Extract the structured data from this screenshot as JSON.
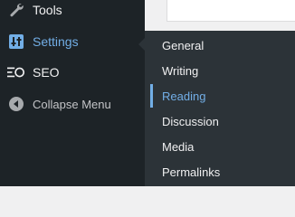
{
  "menu": {
    "tools": {
      "label": "Tools",
      "icon": "wrench-icon"
    },
    "settings": {
      "label": "Settings",
      "icon": "settings-sliders-icon"
    },
    "seo": {
      "label": "SEO",
      "icon": "seo-icon"
    },
    "collapse": {
      "label": "Collapse Menu",
      "icon": "collapse-arrow-icon"
    }
  },
  "submenu": {
    "items": [
      {
        "label": "General"
      },
      {
        "label": "Writing"
      },
      {
        "label": "Reading",
        "active": true
      },
      {
        "label": "Discussion"
      },
      {
        "label": "Media"
      },
      {
        "label": "Permalinks"
      }
    ]
  },
  "colors": {
    "sidebar_bg": "#1d2327",
    "submenu_bg": "#2c3338",
    "accent": "#72aee6",
    "text": "#f0f0f1"
  }
}
